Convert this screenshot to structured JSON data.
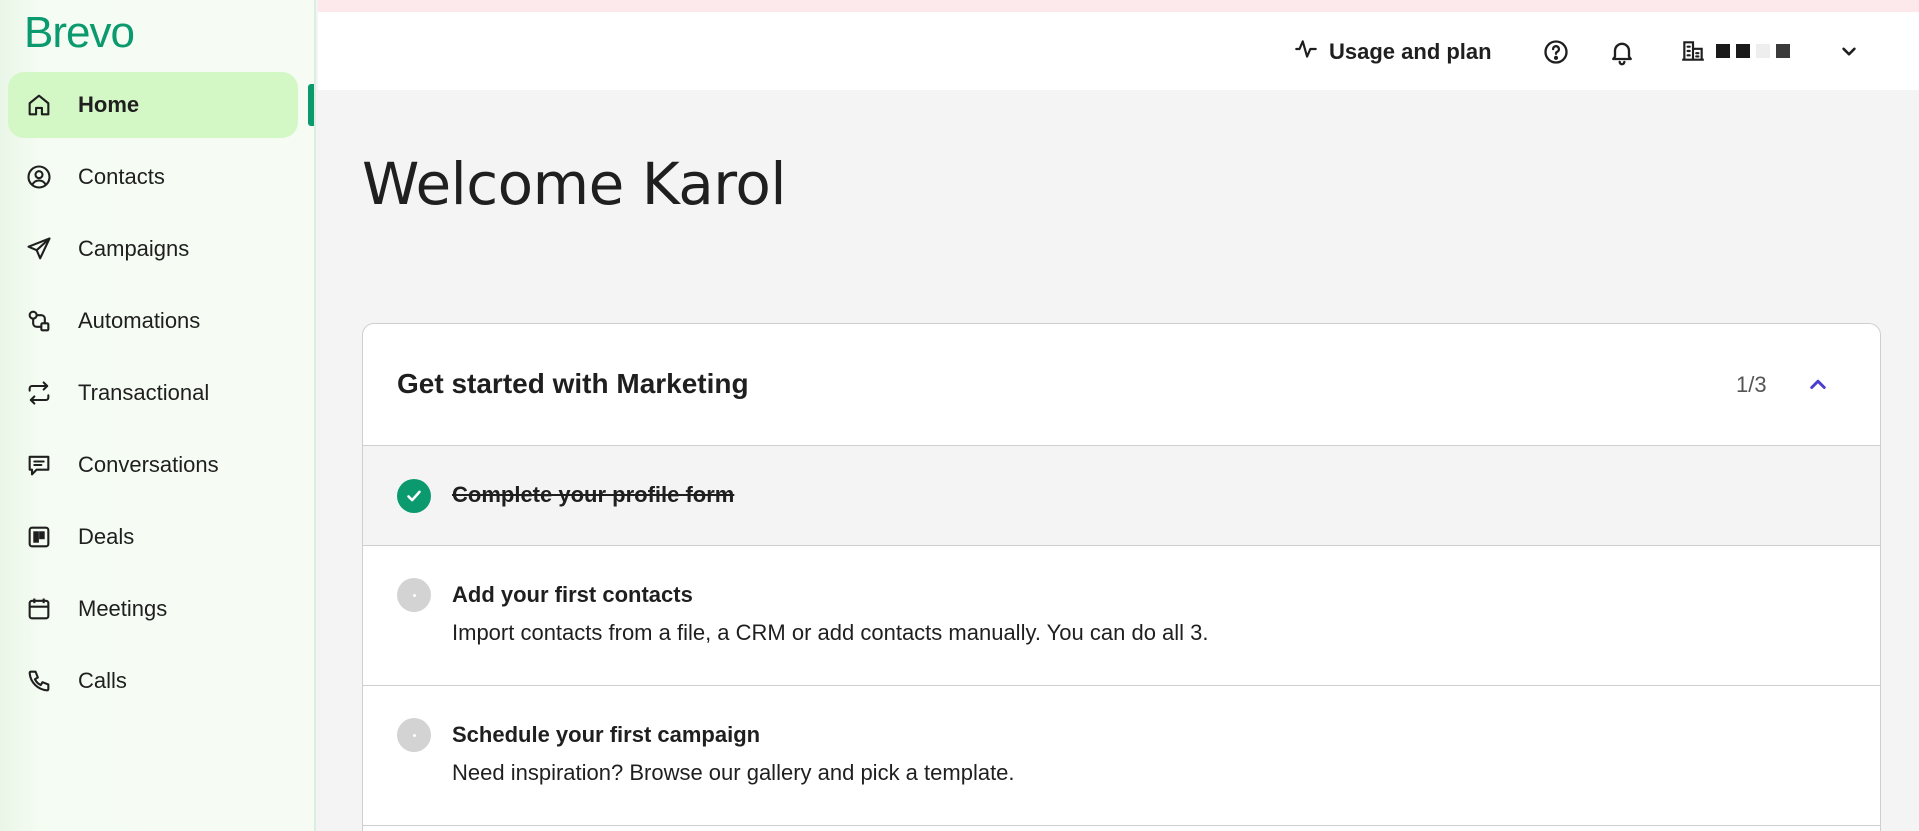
{
  "brand": {
    "logo_text": "Brevo",
    "accent": "#0b996e",
    "active_bg": "#d4f7c6"
  },
  "sidebar": {
    "items": [
      {
        "label": "Home",
        "icon": "home-icon",
        "active": true
      },
      {
        "label": "Contacts",
        "icon": "contacts-icon"
      },
      {
        "label": "Campaigns",
        "icon": "paper-plane-icon"
      },
      {
        "label": "Automations",
        "icon": "automations-icon"
      },
      {
        "label": "Transactional",
        "icon": "repeat-arrows-icon"
      },
      {
        "label": "Conversations",
        "icon": "chat-icon"
      },
      {
        "label": "Deals",
        "icon": "kanban-icon"
      },
      {
        "label": "Meetings",
        "icon": "calendar-icon"
      },
      {
        "label": "Calls",
        "icon": "phone-icon"
      }
    ]
  },
  "topbar": {
    "usage_label": "Usage and plan",
    "usage_icon": "activity-pulse-icon",
    "help_icon": "help-icon",
    "notifications_icon": "bell-icon",
    "org_icon": "building-icon",
    "org_menu_icon": "chevron-down-icon"
  },
  "main": {
    "welcome": "Welcome Karol",
    "onboarding": {
      "title": "Get started with Marketing",
      "progress": "1/3",
      "steps": [
        {
          "title": "Complete your profile form",
          "done": true
        },
        {
          "title": "Add your first contacts",
          "description": "Import contacts from a file, a CRM or add contacts manually. You can do all 3.",
          "done": false
        },
        {
          "title": "Schedule your first campaign",
          "description": "Need inspiration? Browse our gallery and pick a template.",
          "done": false
        }
      ]
    }
  }
}
